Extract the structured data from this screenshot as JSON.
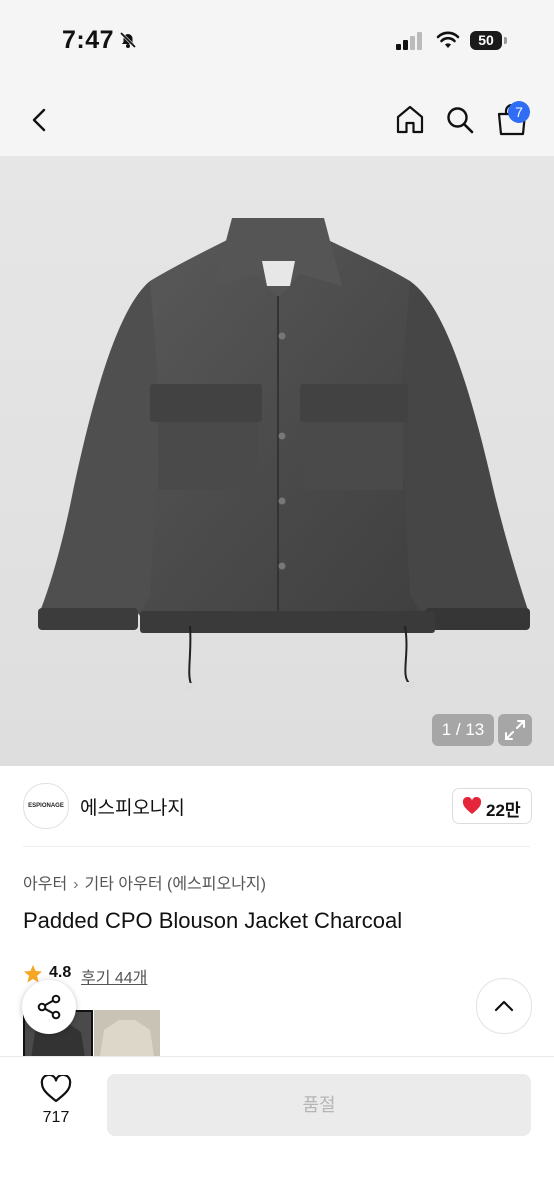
{
  "status_bar": {
    "time": "7:47",
    "battery": "50"
  },
  "header": {
    "cart_count": "7"
  },
  "gallery": {
    "pager": "1 / 13"
  },
  "brand": {
    "logo_text": "ESPIONAGE",
    "name": "에스피오나지",
    "likes": "22만"
  },
  "product": {
    "breadcrumb": [
      "아우터",
      "기타 아우터 (에스피오나지)"
    ],
    "title": "Padded CPO Blouson Jacket Charcoal",
    "rating": "4.8",
    "reviews": "후기 44개"
  },
  "bottom": {
    "wish_count": "717",
    "cta_label": "품절"
  },
  "colors": {
    "accent": "#2f6df5",
    "heart": "#e5263a",
    "star": "#f5a623"
  },
  "icons": [
    "back-icon",
    "home-icon",
    "search-icon",
    "cart-icon",
    "expand-icon",
    "heart-icon",
    "star-icon",
    "share-icon",
    "chevron-up-icon"
  ]
}
